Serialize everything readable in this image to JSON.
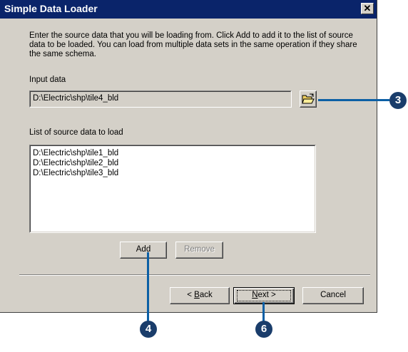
{
  "window": {
    "title": "Simple Data Loader",
    "close_label": "✕"
  },
  "intro_text": "Enter the source data that you will be loading from. Click Add to add it to the list of source data to be loaded. You can load from multiple data sets in the same operation if they share the same schema.",
  "input": {
    "label": "Input data",
    "value": "D:\\Electric\\shp\\tile4_bld",
    "browse_icon": "open-folder-icon"
  },
  "source_list": {
    "label": "List of source data to load",
    "items": [
      "D:\\Electric\\shp\\tile1_bld",
      "D:\\Electric\\shp\\tile2_bld",
      "D:\\Electric\\shp\\tile3_bld"
    ]
  },
  "buttons": {
    "add": "Add",
    "remove": "Remove",
    "back_prefix": "< ",
    "back_accel": "B",
    "back_rest": "ack",
    "next_accel": "N",
    "next_rest": "ext >",
    "cancel": "Cancel"
  },
  "callouts": {
    "browse": "3",
    "add": "4",
    "next": "6"
  },
  "colors": {
    "titlebar": "#0a246a",
    "dialog_bg": "#d4d0c8",
    "callout_line": "#0b5fa5",
    "callout_badge": "#1a3d6b"
  }
}
